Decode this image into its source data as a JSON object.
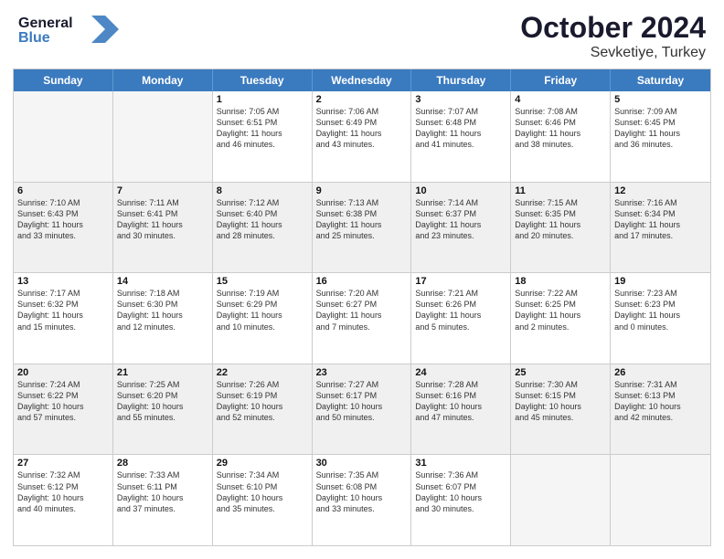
{
  "header": {
    "logo_line1": "General",
    "logo_line2": "Blue",
    "month": "October 2024",
    "location": "Sevketiye, Turkey"
  },
  "days": [
    "Sunday",
    "Monday",
    "Tuesday",
    "Wednesday",
    "Thursday",
    "Friday",
    "Saturday"
  ],
  "weeks": [
    [
      {
        "day": "",
        "info": ""
      },
      {
        "day": "",
        "info": ""
      },
      {
        "day": "1",
        "info": "Sunrise: 7:05 AM\nSunset: 6:51 PM\nDaylight: 11 hours\nand 46 minutes."
      },
      {
        "day": "2",
        "info": "Sunrise: 7:06 AM\nSunset: 6:49 PM\nDaylight: 11 hours\nand 43 minutes."
      },
      {
        "day": "3",
        "info": "Sunrise: 7:07 AM\nSunset: 6:48 PM\nDaylight: 11 hours\nand 41 minutes."
      },
      {
        "day": "4",
        "info": "Sunrise: 7:08 AM\nSunset: 6:46 PM\nDaylight: 11 hours\nand 38 minutes."
      },
      {
        "day": "5",
        "info": "Sunrise: 7:09 AM\nSunset: 6:45 PM\nDaylight: 11 hours\nand 36 minutes."
      }
    ],
    [
      {
        "day": "6",
        "info": "Sunrise: 7:10 AM\nSunset: 6:43 PM\nDaylight: 11 hours\nand 33 minutes."
      },
      {
        "day": "7",
        "info": "Sunrise: 7:11 AM\nSunset: 6:41 PM\nDaylight: 11 hours\nand 30 minutes."
      },
      {
        "day": "8",
        "info": "Sunrise: 7:12 AM\nSunset: 6:40 PM\nDaylight: 11 hours\nand 28 minutes."
      },
      {
        "day": "9",
        "info": "Sunrise: 7:13 AM\nSunset: 6:38 PM\nDaylight: 11 hours\nand 25 minutes."
      },
      {
        "day": "10",
        "info": "Sunrise: 7:14 AM\nSunset: 6:37 PM\nDaylight: 11 hours\nand 23 minutes."
      },
      {
        "day": "11",
        "info": "Sunrise: 7:15 AM\nSunset: 6:35 PM\nDaylight: 11 hours\nand 20 minutes."
      },
      {
        "day": "12",
        "info": "Sunrise: 7:16 AM\nSunset: 6:34 PM\nDaylight: 11 hours\nand 17 minutes."
      }
    ],
    [
      {
        "day": "13",
        "info": "Sunrise: 7:17 AM\nSunset: 6:32 PM\nDaylight: 11 hours\nand 15 minutes."
      },
      {
        "day": "14",
        "info": "Sunrise: 7:18 AM\nSunset: 6:30 PM\nDaylight: 11 hours\nand 12 minutes."
      },
      {
        "day": "15",
        "info": "Sunrise: 7:19 AM\nSunset: 6:29 PM\nDaylight: 11 hours\nand 10 minutes."
      },
      {
        "day": "16",
        "info": "Sunrise: 7:20 AM\nSunset: 6:27 PM\nDaylight: 11 hours\nand 7 minutes."
      },
      {
        "day": "17",
        "info": "Sunrise: 7:21 AM\nSunset: 6:26 PM\nDaylight: 11 hours\nand 5 minutes."
      },
      {
        "day": "18",
        "info": "Sunrise: 7:22 AM\nSunset: 6:25 PM\nDaylight: 11 hours\nand 2 minutes."
      },
      {
        "day": "19",
        "info": "Sunrise: 7:23 AM\nSunset: 6:23 PM\nDaylight: 11 hours\nand 0 minutes."
      }
    ],
    [
      {
        "day": "20",
        "info": "Sunrise: 7:24 AM\nSunset: 6:22 PM\nDaylight: 10 hours\nand 57 minutes."
      },
      {
        "day": "21",
        "info": "Sunrise: 7:25 AM\nSunset: 6:20 PM\nDaylight: 10 hours\nand 55 minutes."
      },
      {
        "day": "22",
        "info": "Sunrise: 7:26 AM\nSunset: 6:19 PM\nDaylight: 10 hours\nand 52 minutes."
      },
      {
        "day": "23",
        "info": "Sunrise: 7:27 AM\nSunset: 6:17 PM\nDaylight: 10 hours\nand 50 minutes."
      },
      {
        "day": "24",
        "info": "Sunrise: 7:28 AM\nSunset: 6:16 PM\nDaylight: 10 hours\nand 47 minutes."
      },
      {
        "day": "25",
        "info": "Sunrise: 7:30 AM\nSunset: 6:15 PM\nDaylight: 10 hours\nand 45 minutes."
      },
      {
        "day": "26",
        "info": "Sunrise: 7:31 AM\nSunset: 6:13 PM\nDaylight: 10 hours\nand 42 minutes."
      }
    ],
    [
      {
        "day": "27",
        "info": "Sunrise: 7:32 AM\nSunset: 6:12 PM\nDaylight: 10 hours\nand 40 minutes."
      },
      {
        "day": "28",
        "info": "Sunrise: 7:33 AM\nSunset: 6:11 PM\nDaylight: 10 hours\nand 37 minutes."
      },
      {
        "day": "29",
        "info": "Sunrise: 7:34 AM\nSunset: 6:10 PM\nDaylight: 10 hours\nand 35 minutes."
      },
      {
        "day": "30",
        "info": "Sunrise: 7:35 AM\nSunset: 6:08 PM\nDaylight: 10 hours\nand 33 minutes."
      },
      {
        "day": "31",
        "info": "Sunrise: 7:36 AM\nSunset: 6:07 PM\nDaylight: 10 hours\nand 30 minutes."
      },
      {
        "day": "",
        "info": ""
      },
      {
        "day": "",
        "info": ""
      }
    ]
  ]
}
